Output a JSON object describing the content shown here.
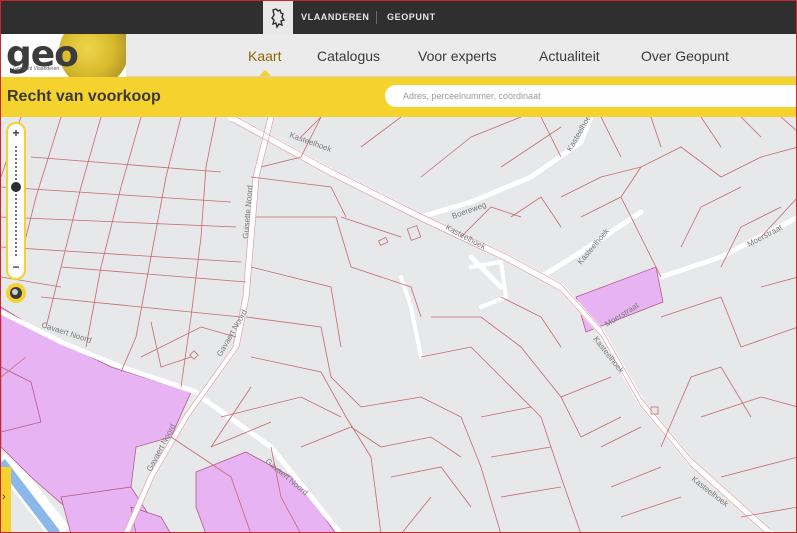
{
  "gov_bar": {
    "links": [
      "VLAANDEREN",
      "GEOPUNT"
    ]
  },
  "logo": {
    "text": "geo",
    "subtitle": "Geopunt Vlaanderen"
  },
  "nav": {
    "items": [
      {
        "label": "Kaart",
        "active": true
      },
      {
        "label": "Catalogus",
        "active": false
      },
      {
        "label": "Voor experts",
        "active": false
      },
      {
        "label": "Actualiteit",
        "active": false
      },
      {
        "label": "Over Geopunt",
        "active": false
      }
    ]
  },
  "title_bar": {
    "title": "Recht van voorkoop",
    "search_placeholder": "Adres, perceelnummer, coördinaat"
  },
  "map": {
    "street_labels": [
      "Kasteelhoek",
      "Boereweg",
      "Kasteelhoek",
      "Kasteelhoek",
      "Moerstraat",
      "Moerstraat",
      "Kasteelhoek",
      "Kasteelhoek",
      "Guisette Noord",
      "Cavaert Noord",
      "Gavaert Noord",
      "Gavaert Noord",
      "Kasteelhoek",
      "Gavaert Noord"
    ],
    "colors": {
      "background": "#e6e8ea",
      "parcel_line": "#c8696e",
      "highlight_fill": "#e7b3f2",
      "road": "#ffffff",
      "canal": "#8bb8e8"
    }
  },
  "zoom": {
    "plus": "+",
    "minus": "−"
  },
  "side_tab": {
    "arrow": "›"
  }
}
